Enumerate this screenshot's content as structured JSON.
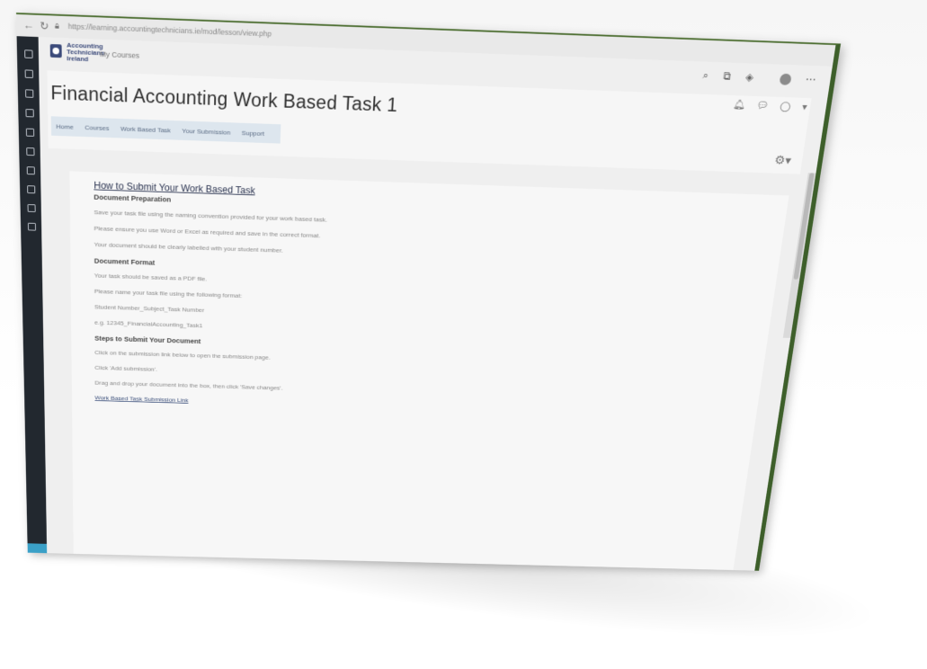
{
  "browser": {
    "url": "https://learning.accountingtechnicians.ie/mod/lesson/view.php"
  },
  "header": {
    "brand_line1": "Accounting",
    "brand_line2": "Technicians",
    "brand_line3": "Ireland",
    "my_courses": "My Courses"
  },
  "page": {
    "title": "Financial Accounting Work Based Task 1",
    "tabs": [
      "Home",
      "Courses",
      "Work Based Task",
      "Your Submission",
      "Support"
    ]
  },
  "article": {
    "heading": "How to Submit Your Work Based Task",
    "subheading": "Document Preparation",
    "paragraphs_1": [
      "Save your task file using the naming convention provided for your work based task.",
      "Please ensure you use Word or Excel as required and save in the correct format.",
      "Your document should be clearly labelled with your student number."
    ],
    "subheading_2": "Document Format",
    "paragraphs_2": [
      "Your task should be saved as a PDF file.",
      "Please name your task file using the following format:",
      "Student Number_Subject_Task Number",
      "e.g. 12345_FinancialAccounting_Task1"
    ],
    "subheading_3": "Steps to Submit Your Document",
    "paragraphs_3": [
      "Click on the submission link below to open the submission page.",
      "Click 'Add submission'.",
      "Drag and drop your document into the box, then click 'Save changes'."
    ],
    "link_text": "Work Based Task Submission Link"
  },
  "colors": {
    "sidebar": "#22282f",
    "accent": "#3aa0c7",
    "frame": "#3d5f2a",
    "tab_bar": "#dde6ee"
  },
  "icons": [
    "back-arrow-icon",
    "reload-icon",
    "lock-icon",
    "search-icon",
    "extension-icon",
    "profile-icon",
    "menu-icon",
    "bell-icon",
    "chat-icon",
    "gear-icon"
  ]
}
